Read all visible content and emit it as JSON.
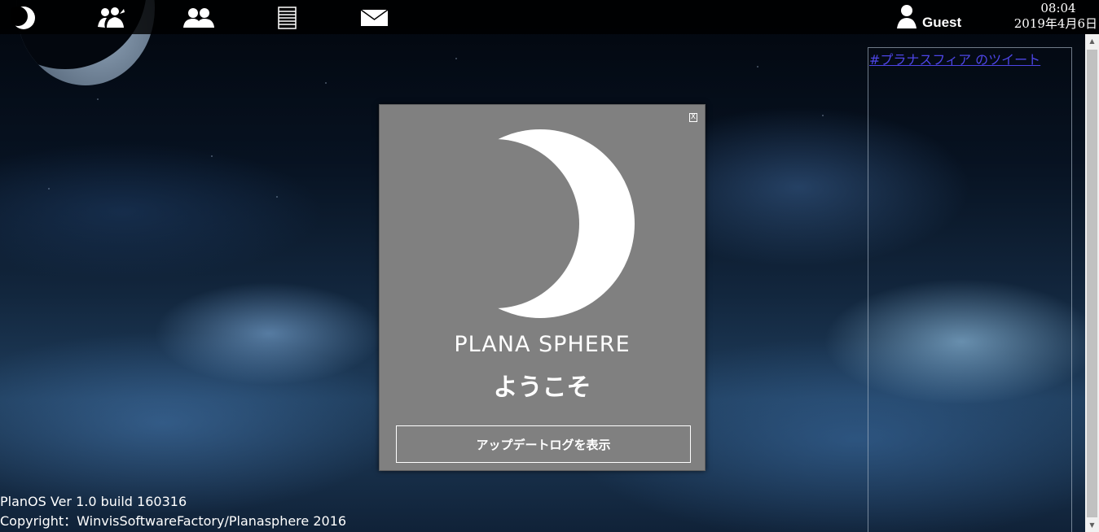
{
  "taskbar": {
    "icons": [
      "moon-menu-icon",
      "friends-icon",
      "group-icon",
      "list-icon",
      "mail-icon"
    ],
    "user": {
      "name": "Guest",
      "icon": "user-icon"
    },
    "clock": {
      "time": "08:04",
      "date": "2019年4月6日"
    }
  },
  "tweets": {
    "link_text": "#プラナスフィア のツイート"
  },
  "dialog": {
    "brand": "PLANA SPHERE",
    "welcome": "ようこそ",
    "button_label": "アップデートログを表示",
    "close_label": "X"
  },
  "footer": {
    "version": "PlanOS Ver 1.0 build 160316",
    "copyright": "Copyright：WinvisSoftwareFactory/Planasphere 2016"
  },
  "colors": {
    "dialog_bg": "#808080",
    "link": "#4d45e6",
    "taskbar": "#000000"
  }
}
